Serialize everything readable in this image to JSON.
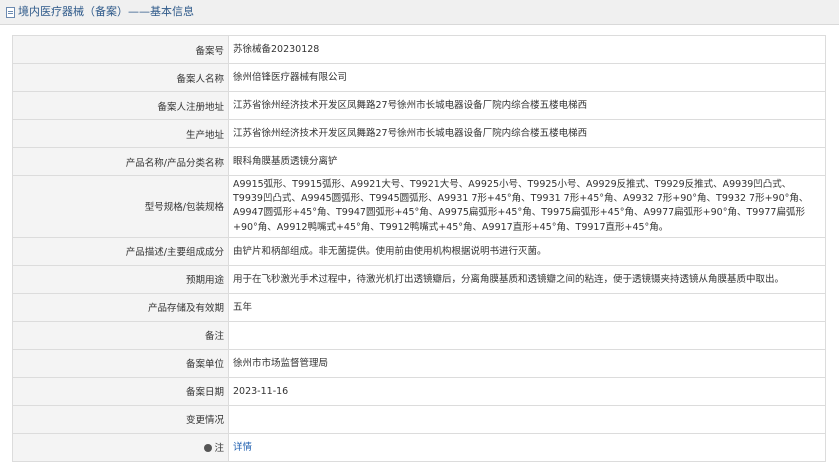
{
  "header": {
    "title": "境内医疗器械（备案）——基本信息"
  },
  "rows": [
    {
      "label": "备案号",
      "value": "苏徐械备20230128"
    },
    {
      "label": "备案人名称",
      "value": "徐州倍锋医疗器械有限公司"
    },
    {
      "label": "备案人注册地址",
      "value": "江苏省徐州经济技术开发区凤舞路27号徐州市长城电器设备厂院内综合楼五楼电梯西"
    },
    {
      "label": "生产地址",
      "value": "江苏省徐州经济技术开发区凤舞路27号徐州市长城电器设备厂院内综合楼五楼电梯西"
    },
    {
      "label": "产品名称/产品分类名称",
      "value": "眼科角膜基质透镜分离铲"
    },
    {
      "label": "型号规格/包装规格",
      "value": "A9915弧形、T9915弧形、A9921大号、T9921大号、A9925小号、T9925小号、A9929反推式、T9929反推式、A9939凹凸式、T9939凹凸式、A9945圆弧形、T9945圆弧形、A9931 7形+45°角、T9931 7形+45°角、A9932 7形+90°角、T9932 7形+90°角、A9947圆弧形+45°角、T9947圆弧形+45°角、A9975扁弧形+45°角、T9975扁弧形+45°角、A9977扁弧形+90°角、T9977扁弧形+90°角、A9912鸭嘴式+45°角、T9912鸭嘴式+45°角、A9917直形+45°角、T9917直形+45°角。"
    },
    {
      "label": "产品描述/主要组成成分",
      "value": "由铲片和柄部组成。非无菌提供。使用前由使用机构根据说明书进行灭菌。"
    },
    {
      "label": "预期用途",
      "value": "用于在飞秒激光手术过程中，待激光机打出透镜瓣后，分离角膜基质和透镜瓣之间的粘连，便于透镜镊夹持透镜从角膜基质中取出。"
    },
    {
      "label": "产品存储及有效期",
      "value": "五年"
    },
    {
      "label": "备注",
      "value": ""
    },
    {
      "label": "备案单位",
      "value": "徐州市市场监督管理局"
    },
    {
      "label": "备案日期",
      "value": "2023-11-16"
    },
    {
      "label": "变更情况",
      "value": ""
    }
  ],
  "note": {
    "label": "注",
    "link": "详情"
  },
  "icons": {
    "header": "document-icon",
    "note": "info-icon"
  }
}
